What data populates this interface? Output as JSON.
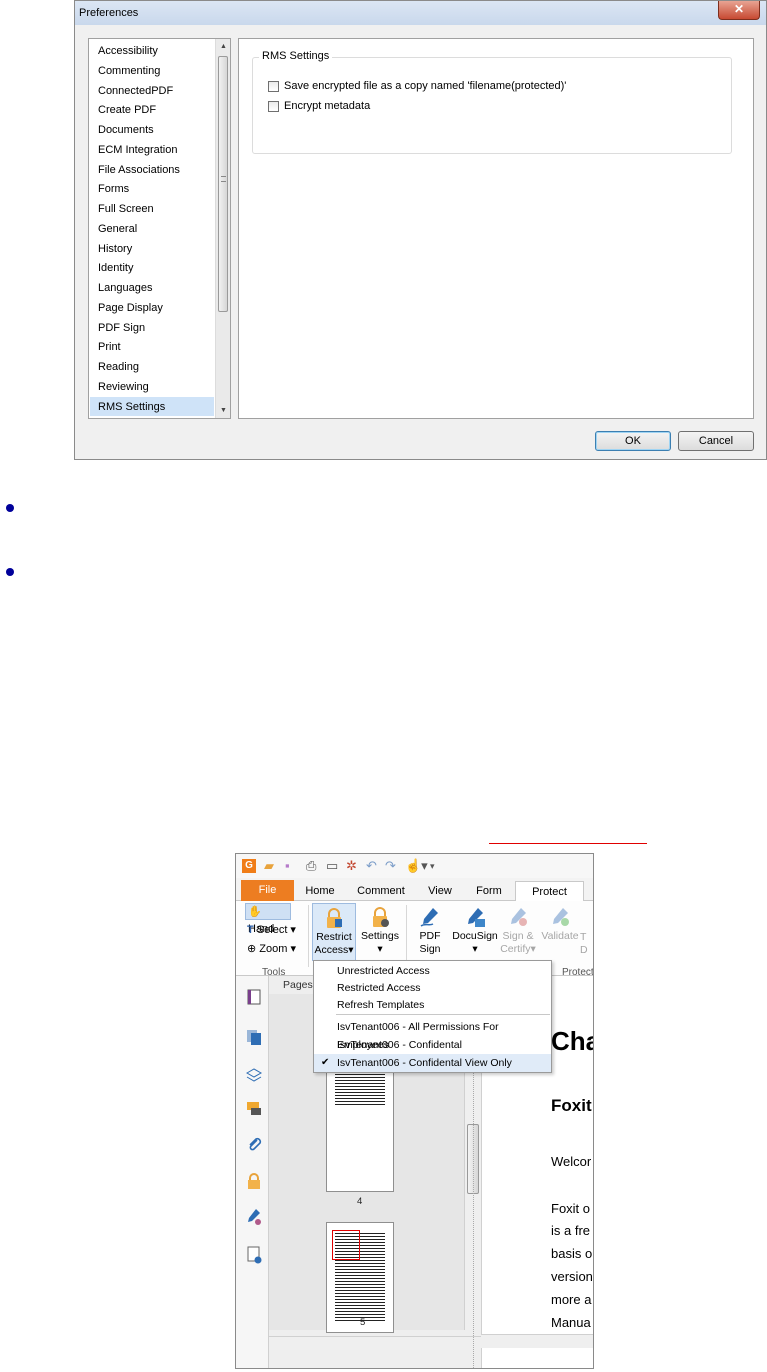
{
  "dialog": {
    "title": "Preferences",
    "close_glyph": "✕",
    "categories": [
      "Accessibility",
      "Commenting",
      "ConnectedPDF",
      "Create PDF",
      "Documents",
      "ECM Integration",
      "File Associations",
      "Forms",
      "Full Screen",
      "General",
      "History",
      "Identity",
      "Languages",
      "Page Display",
      "PDF Sign",
      "Print",
      "Reading",
      "Reviewing",
      "RMS Settings"
    ],
    "selected_category": "RMS Settings",
    "group_title": "RMS Settings",
    "options": [
      {
        "label": "Save encrypted file as a copy named 'filename(protected)'",
        "checked": false
      },
      {
        "label": "Encrypt metadata",
        "checked": false
      }
    ],
    "ok_label": "OK",
    "cancel_label": "Cancel"
  },
  "foxit": {
    "tabs": [
      "File",
      "Home",
      "Comment",
      "View",
      "Form",
      "Protect"
    ],
    "active_tab": "Protect",
    "tools": [
      "Hand",
      "Select",
      "Zoom"
    ],
    "tools_group_label": "Tools",
    "protect_group_label": "Protect",
    "buttons": [
      {
        "label1": "Restrict",
        "label2": "Access"
      },
      {
        "label1": "Settings",
        "label2": ""
      },
      {
        "label1": "PDF",
        "label2": "Sign"
      },
      {
        "label1": "DocuSign",
        "label2": ""
      },
      {
        "label1": "Sign &",
        "label2": "Certify"
      },
      {
        "label1": "Validate",
        "label2": ""
      },
      {
        "label1": "T",
        "label2": "D"
      }
    ],
    "pages_panel_title": "Pages",
    "page_numbers": [
      "4",
      "5"
    ],
    "doc": {
      "title": "Cha",
      "heading": "Foxit",
      "lines": [
        "Welcor",
        "Foxit o",
        "is a fre",
        "basis o",
        "version",
        "more a",
        "Manua"
      ]
    }
  },
  "menu": {
    "items": [
      "Unrestricted Access",
      "Restricted Access",
      "Refresh Templates",
      "IsvTenant006 - All Permissions For Employees",
      "IsvTenant006 - Confidental",
      "IsvTenant006 - Confidental View Only"
    ],
    "checked_item": "IsvTenant006 - Confidental View Only",
    "check_glyph": "✔"
  },
  "colors": {
    "accent_orange": "#ed7d21",
    "bullet_blue": "#00009a",
    "annotation_red": "#e00000"
  }
}
